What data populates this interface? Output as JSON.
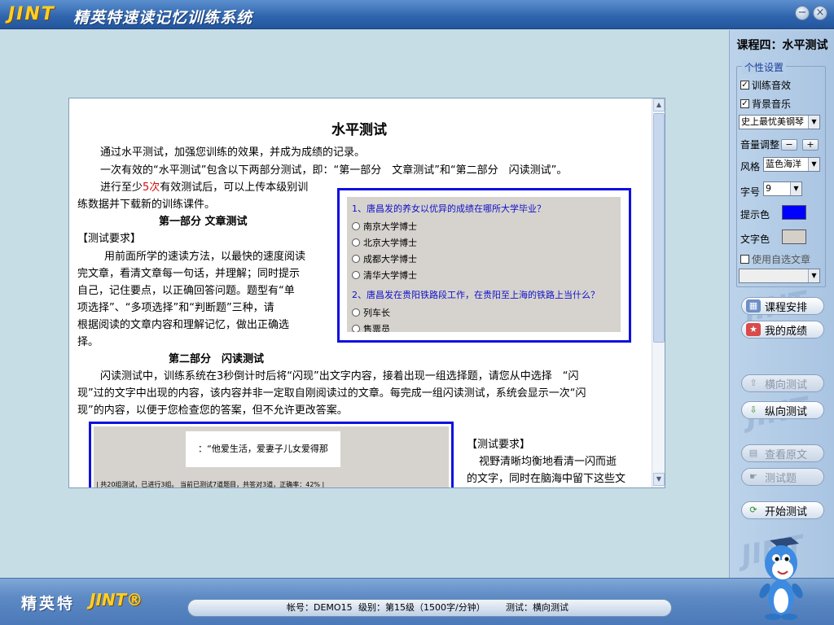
{
  "titlebar": {
    "logo": "JINT",
    "title": "精英特速读记忆训练系统",
    "minimize": "−",
    "close": "×"
  },
  "sidebar": {
    "lesson_title": "课程四：水平测试",
    "settings_legend": "个性设置",
    "training_sound": "训练音效",
    "training_sound_checked": true,
    "bg_music": "背景音乐",
    "bg_music_checked": true,
    "music_select": "史上最忧美钢琴",
    "volume_label": "音量调整",
    "vol_down": "−",
    "vol_up": "+",
    "style_label": "风格",
    "style_select": "蓝色海洋",
    "font_size_label": "字号",
    "font_size_select": "9",
    "prompt_color_label": "提示色",
    "prompt_color": "#0000ff",
    "text_color_label": "文字色",
    "text_color": "#d4d0c8",
    "custom_text_label": "使用自选文章",
    "custom_text_checked": false,
    "buttons": {
      "schedule": "课程安排",
      "my_scores": "我的成绩",
      "horizontal_test": "横向测试",
      "vertical_test": "纵向测试",
      "view_original": "查看原文",
      "test_questions": "测试题",
      "start_test": "开始测试"
    },
    "watermark": "JINT"
  },
  "doc": {
    "title": "水平测试",
    "para1": "通过水平测试，加强您训练的效果，并成为成绩的记录。",
    "para2": "一次有效的“水平测试”包含以下两部分测试，即：“第一部分　文章测试”和“第二部分　闪读测试”。",
    "para3_pre": "进行至少",
    "para3_count": "5次",
    "para3_post": "有效测试后，可以上传本级别训",
    "para3_line2": "练数据并下载新的训练课件。",
    "part1_title": "第一部分  文章测试",
    "req_label": "【测试要求】",
    "part1_lines": [
      "　用前面所学的速读方法，以最快的速度阅读",
      "完文章，看清文章每一句话，并理解；同时提示",
      "自己，记住要点，以正确回答问题。题型有“单",
      "项选择”、“多项选择”和“判断题”三种，请",
      "根据阅读的文章内容和理解记忆，做出正确选",
      "择。"
    ],
    "part2_title": "第二部分　闪读测试",
    "part2_lines": [
      "闪读测试中，训练系统在3秒倒计时后将“闪现”出文字内容，接着出现一组选择题，请您从中选择　“闪",
      "现”过的文字中出现的内容，该内容并非一定取自刚阅读过的文章。每完成一组闪读测试，系统会显示一次“闪",
      "现”的内容，以便于您检查您的答案，但不允许更改答案。"
    ],
    "req_label2": "【测试要求】",
    "req2_lines": [
      "　视野清晰均衡地看清一闪而逝",
      "的文字，同时在脑海中留下这些文"
    ],
    "quiz": {
      "q1": "1、唐昌发的养女以优异的成绩在哪所大学毕业？",
      "q1_options": [
        "南京大学博士",
        "北京大学博士",
        "成都大学博士",
        "清华大学博士"
      ],
      "q2": "2、唐昌发在贵阳铁路段工作，在贵阳至上海的铁路上当什么？",
      "q2_options": [
        "列车长",
        "售票员"
      ]
    },
    "flash": {
      "card_text": "：“他爱生活，爱妻子儿女爱得那",
      "status": "| 共20组测试，已进行3组。  当前已测试7道题目，共答对3道，正确率：42%    |"
    }
  },
  "bottombar": {
    "brand": "精英特",
    "brand_logo": "JINT®",
    "account": "帐号：DEMO15",
    "level": "级别：第15级（1500字/分钟）",
    "test": "测试：横向测试"
  }
}
